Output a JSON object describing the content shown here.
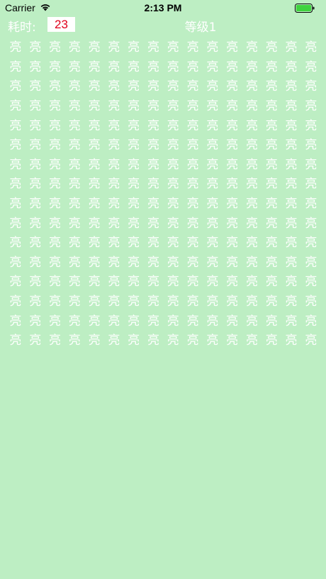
{
  "status_bar": {
    "carrier": "Carrier",
    "time": "2:13 PM",
    "battery_color": "#3fd33f"
  },
  "header": {
    "time_label": "耗时:",
    "time_value": "23",
    "level_label": "等级1"
  },
  "grid": {
    "rows": 16,
    "columns": 16,
    "char": "亮",
    "odd_char": "亮",
    "odd_row": 13,
    "odd_col": 5
  },
  "colors": {
    "background": "#bdeec3",
    "text": "#ffffff",
    "time_value": "#e0001b"
  }
}
